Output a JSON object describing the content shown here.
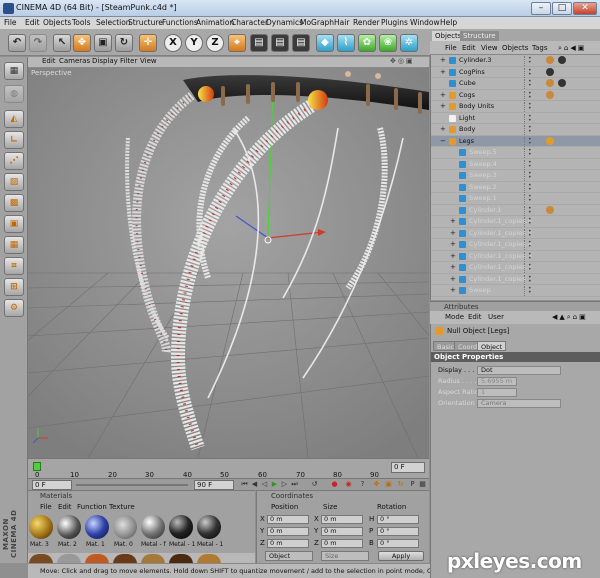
{
  "window": {
    "title": "CINEMA 4D (64 Bit) - [SteamPunk.c4d *]",
    "minimize": "–",
    "maximize": "□",
    "close": "✕"
  },
  "menubar": [
    "File",
    "Edit",
    "Objects",
    "Tools",
    "Selection",
    "Structure",
    "Functions",
    "Animation",
    "Character",
    "Dynamics",
    "MoGraph",
    "Hair",
    "Render",
    "Plugins",
    "Window",
    "Help"
  ],
  "toolbar": {
    "axes": [
      "X",
      "Y",
      "Z"
    ]
  },
  "viewport": {
    "menu": [
      "Edit",
      "Cameras",
      "Display",
      "Filter",
      "View"
    ],
    "label": "Perspective"
  },
  "timeline": {
    "ticks": [
      "0",
      "10",
      "20",
      "30",
      "40",
      "50",
      "60",
      "70",
      "80",
      "90"
    ],
    "current_frame": "0 F",
    "start_field": "0 F",
    "end_field": "90 F"
  },
  "materials_panel": {
    "title": "Materials",
    "menu": [
      "File",
      "Edit",
      "Function",
      "Texture"
    ],
    "items": [
      {
        "label": "Mat. 3",
        "color": "#2b2b2b"
      },
      {
        "label": "Mat. 2",
        "color": "#555"
      },
      {
        "label": "Mat. 1",
        "color": "#2e43a6"
      },
      {
        "label": "Mat. 0",
        "color": "#aaa"
      },
      {
        "label": "Metal - f",
        "color": "#777"
      },
      {
        "label": "Metal - 1",
        "color": "#222"
      },
      {
        "label": "Metal - 1",
        "color": "#333"
      }
    ]
  },
  "coordinates_panel": {
    "title": "Coordinates",
    "headers": [
      "Position",
      "Size",
      "Rotation"
    ],
    "rows": [
      {
        "axis": "X",
        "pos": "0 m",
        "size_axis": "X",
        "size": "0 m",
        "rot_axis": "H",
        "rot": "0 °"
      },
      {
        "axis": "Y",
        "pos": "0 m",
        "size_axis": "Y",
        "size": "0 m",
        "rot_axis": "P",
        "rot": "0 °"
      },
      {
        "axis": "Z",
        "pos": "0 m",
        "size_axis": "Z",
        "size": "0 m",
        "rot_axis": "B",
        "rot": "0 °"
      }
    ],
    "mode_dropdown": "Object",
    "size_dropdown": "Size",
    "apply_label": "Apply"
  },
  "status_bar": "Move: Click and drag to move elements. Hold down SHIFT to quantize movement / add to the selection in point mode, CTRL to remove.",
  "object_manager": {
    "tabs": [
      "Objects",
      "Structure"
    ],
    "menu": [
      "File",
      "Edit",
      "View",
      "Objects",
      "Tags"
    ],
    "rows": [
      {
        "name": "Cylinder.3",
        "indent": 0,
        "expand": "+",
        "faded": false,
        "selected": false,
        "icon": "#2f8fd0"
      },
      {
        "name": "CogPins",
        "indent": 0,
        "expand": "+",
        "faded": false,
        "selected": false,
        "icon": "#2f8fd0"
      },
      {
        "name": "Cube",
        "indent": 0,
        "expand": "",
        "faded": false,
        "selected": false,
        "icon": "#2f8fd0"
      },
      {
        "name": "Cogs",
        "indent": 0,
        "expand": "+",
        "faded": false,
        "selected": false,
        "icon": "#e39a2b"
      },
      {
        "name": "Body Units",
        "indent": 0,
        "expand": "+",
        "faded": false,
        "selected": false,
        "icon": "#e39a2b"
      },
      {
        "name": "Light",
        "indent": 0,
        "expand": "",
        "faded": false,
        "selected": false,
        "icon": "#f2f2f2"
      },
      {
        "name": "Body",
        "indent": 0,
        "expand": "+",
        "faded": false,
        "selected": false,
        "icon": "#e39a2b"
      },
      {
        "name": "Legs",
        "indent": 0,
        "expand": "−",
        "faded": false,
        "selected": true,
        "icon": "#e39a2b"
      },
      {
        "name": "Sweep.5",
        "indent": 1,
        "expand": "",
        "faded": true,
        "selected": false,
        "icon": "#2f8fd0"
      },
      {
        "name": "Sweep.4",
        "indent": 1,
        "expand": "",
        "faded": true,
        "selected": false,
        "icon": "#2f8fd0"
      },
      {
        "name": "Sweep.3",
        "indent": 1,
        "expand": "",
        "faded": true,
        "selected": false,
        "icon": "#2f8fd0"
      },
      {
        "name": "Sweep.2",
        "indent": 1,
        "expand": "",
        "faded": true,
        "selected": false,
        "icon": "#2f8fd0"
      },
      {
        "name": "Sweep.1",
        "indent": 1,
        "expand": "",
        "faded": true,
        "selected": false,
        "icon": "#2f8fd0"
      },
      {
        "name": "Cylinder.1",
        "indent": 1,
        "expand": "",
        "faded": true,
        "selected": false,
        "icon": "#2f8fd0"
      },
      {
        "name": "Cylinder.1_copies.6",
        "indent": 1,
        "expand": "+",
        "faded": true,
        "selected": false,
        "icon": "#2f8fd0"
      },
      {
        "name": "Cylinder.1_copies.5",
        "indent": 1,
        "expand": "+",
        "faded": true,
        "selected": false,
        "icon": "#2f8fd0"
      },
      {
        "name": "Cylinder.1_copies.4",
        "indent": 1,
        "expand": "+",
        "faded": true,
        "selected": false,
        "icon": "#2f8fd0"
      },
      {
        "name": "Cylinder.1_copies.3",
        "indent": 1,
        "expand": "+",
        "faded": true,
        "selected": false,
        "icon": "#2f8fd0"
      },
      {
        "name": "Cylinder.1_copies.2",
        "indent": 1,
        "expand": "+",
        "faded": true,
        "selected": false,
        "icon": "#2f8fd0"
      },
      {
        "name": "Cylinder.1_copies",
        "indent": 1,
        "expand": "+",
        "faded": true,
        "selected": false,
        "icon": "#2f8fd0"
      },
      {
        "name": "Sweep",
        "indent": 1,
        "expand": "+",
        "faded": true,
        "selected": false,
        "icon": "#2f8fd0"
      }
    ]
  },
  "attributes": {
    "title": "Attributes",
    "menu": [
      "Mode",
      "Edit",
      "User"
    ],
    "object_title": "Null Object [Legs]",
    "tabs": [
      "Basic",
      "Coord.",
      "Object"
    ],
    "active_tab": "Object",
    "section": "Object Properties",
    "fields": [
      {
        "label": "Display . . . .",
        "value": "Dot",
        "dim": false
      },
      {
        "label": "Radius . . . .",
        "value": "5.6955 m",
        "dim": true
      },
      {
        "label": "Aspect Ratio",
        "value": "1",
        "dim": true
      },
      {
        "label": "Orientation",
        "value": "Camera",
        "dim": true
      }
    ]
  },
  "branding": {
    "maxon": "MAXON CINEMA 4D",
    "watermark": "pxleyes.com"
  },
  "colors": {
    "accent": "#e3902a",
    "selection": "#8e98a6",
    "legs_red": "#cc2222"
  }
}
